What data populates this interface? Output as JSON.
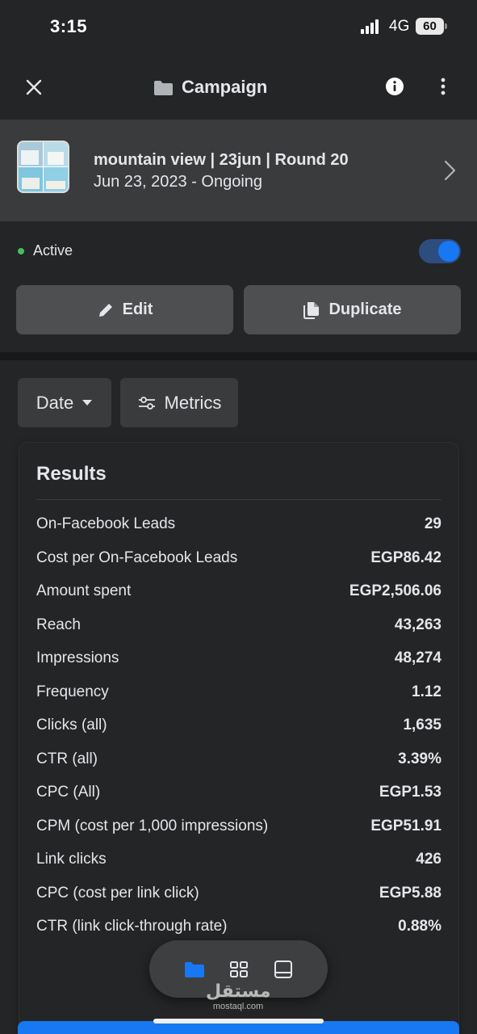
{
  "status_bar": {
    "time": "3:15",
    "network": "4G",
    "battery": "60"
  },
  "header": {
    "title": "Campaign",
    "icons": {
      "close": "close-icon",
      "folder": "folder-icon",
      "info": "info-icon",
      "more": "more-vertical-icon"
    }
  },
  "campaign": {
    "name": "mountain view | 23jun | Round 20",
    "date_status": "Jun 23, 2023 -  Ongoing"
  },
  "status": {
    "label": "Active",
    "enabled": true,
    "dot_color": "#45bd62",
    "toggle_color": "#1877f2"
  },
  "actions": {
    "edit_label": "Edit",
    "duplicate_label": "Duplicate"
  },
  "filters": {
    "date_label": "Date",
    "metrics_label": "Metrics"
  },
  "results": {
    "title": "Results",
    "rows": [
      {
        "name": "On-Facebook Leads",
        "value": "29"
      },
      {
        "name": "Cost per On-Facebook Leads",
        "value": "EGP86.42"
      },
      {
        "name": "Amount spent",
        "value": "EGP2,506.06"
      },
      {
        "name": "Reach",
        "value": "43,263"
      },
      {
        "name": "Impressions",
        "value": "48,274"
      },
      {
        "name": "Frequency",
        "value": "1.12"
      },
      {
        "name": "Clicks (all)",
        "value": "1,635"
      },
      {
        "name": "CTR (all)",
        "value": "3.39%"
      },
      {
        "name": "CPC (All)",
        "value": "EGP1.53"
      },
      {
        "name": "CPM (cost per 1,000 impressions)",
        "value": "EGP51.91"
      },
      {
        "name": "Link clicks",
        "value": "426"
      },
      {
        "name": "CPC (cost per link click)",
        "value": "EGP5.88"
      },
      {
        "name": "CTR (link click-through rate)",
        "value": "0.88%"
      }
    ]
  },
  "bottom_nav": {
    "icons": [
      "folder-icon",
      "grid-icon",
      "tablet-icon"
    ],
    "active_color": "#1877f2"
  },
  "watermark": {
    "main": "مستقل",
    "sub": "mostaql.com"
  },
  "accent_color": "#1877f2"
}
